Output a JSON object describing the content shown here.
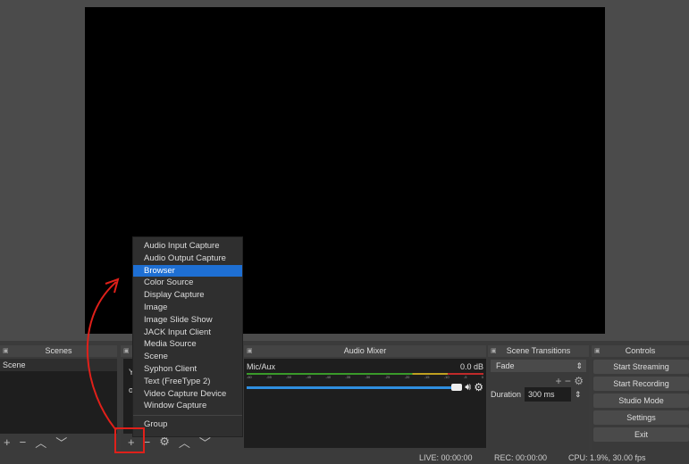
{
  "panels": {
    "scenes": "Scenes",
    "audio_mixer": "Audio Mixer",
    "scene_transitions": "Scene Transitions",
    "controls": "Controls"
  },
  "scenes": {
    "items": [
      "Scene"
    ]
  },
  "sources_partial": [
    "Y",
    "o"
  ],
  "audio": {
    "channel": "Mic/Aux",
    "level": "0.0 dB",
    "ticks": [
      "-60",
      "-55",
      "-50",
      "-45",
      "-40",
      "-35",
      "-30",
      "-25",
      "-20",
      "-15",
      "-10",
      "-5",
      "0"
    ],
    "volume": 0.93
  },
  "transitions": {
    "selected": "Fade",
    "duration_label": "Duration",
    "duration": "300 ms"
  },
  "controls": [
    "Start Streaming",
    "Start Recording",
    "Studio Mode",
    "Settings",
    "Exit"
  ],
  "menu": {
    "items": [
      "Audio Input Capture",
      "Audio Output Capture",
      "Browser",
      "Color Source",
      "Display Capture",
      "Image",
      "Image Slide Show",
      "JACK Input Client",
      "Media Source",
      "Scene",
      "Syphon Client",
      "Text (FreeType 2)",
      "Video Capture Device",
      "Window Capture"
    ],
    "selected": "Browser",
    "group": "Group"
  },
  "status": {
    "live": "LIVE: 00:00:00",
    "rec": "REC: 00:00:00",
    "cpu": "CPU: 1.9%, 30.00 fps"
  },
  "colors": {
    "highlight": "#1e6fd3",
    "annotation": "#e0201a",
    "volume": "#2f8fe0"
  }
}
